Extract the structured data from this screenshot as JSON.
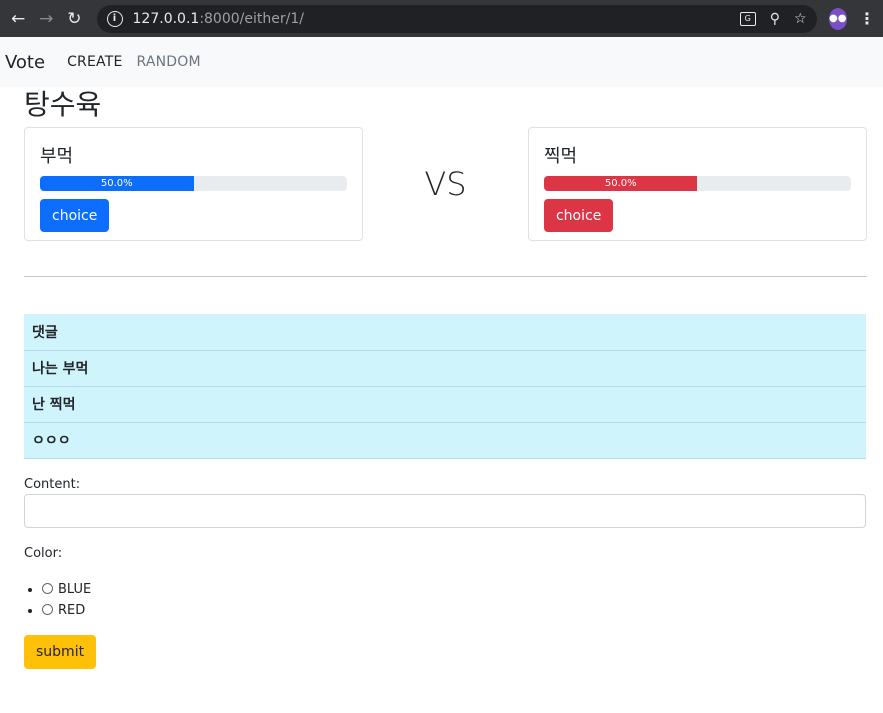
{
  "browser": {
    "url_host": "127.0.0.1",
    "url_rest": ":8000/either/1/"
  },
  "navbar": {
    "brand": "Vote",
    "links": [
      "CREATE",
      "RANDOM"
    ]
  },
  "poll": {
    "title": "탕수육",
    "vs_label": "VS",
    "left": {
      "label": "부먹",
      "percent_text": "50.0%",
      "percent": 50.0,
      "button": "choice",
      "color": "#0d6efd"
    },
    "right": {
      "label": "찍먹",
      "percent_text": "50.0%",
      "percent": 50.0,
      "button": "choice",
      "color": "#dc3545"
    }
  },
  "comments": {
    "rows": [
      "댓글",
      "나는 부먹",
      "난 찍먹",
      "ㅇㅇㅇ"
    ]
  },
  "form": {
    "content_label": "Content:",
    "content_value": "",
    "color_label": "Color:",
    "options": [
      "BLUE",
      "RED"
    ],
    "submit_label": "submit"
  }
}
